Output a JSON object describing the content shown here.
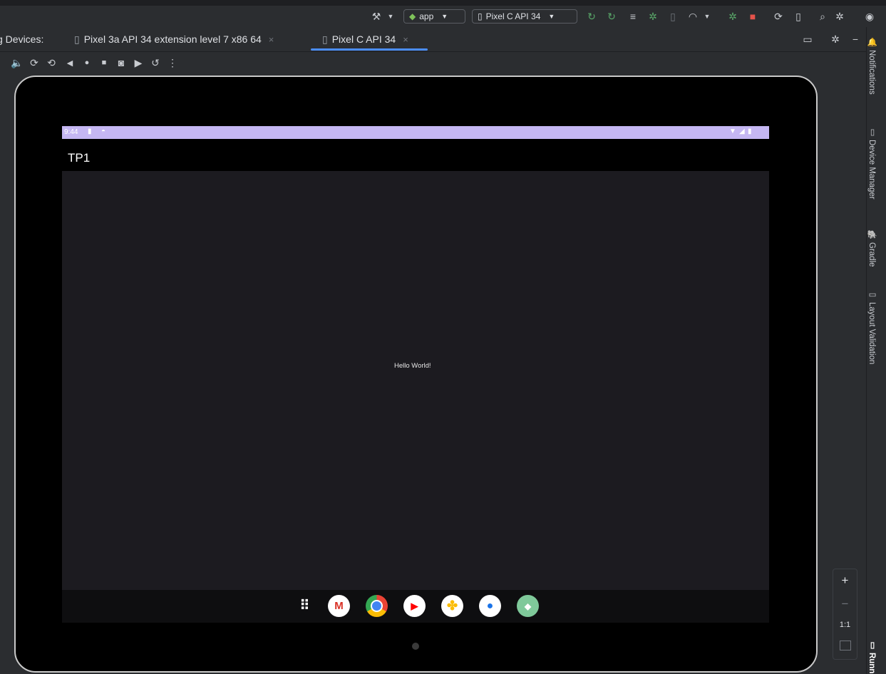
{
  "toolbar": {
    "run_config": "app",
    "device_selector": "Pixel C API 34"
  },
  "tabs": {
    "prefix": "g Devices:",
    "items": [
      {
        "label": "Pixel 3a API 34 extension level 7 x86 64",
        "active": false
      },
      {
        "label": "Pixel C API 34",
        "active": true
      }
    ]
  },
  "right_panel": {
    "notifications": "Notifications",
    "device_manager": "Device Manager",
    "gradle": "Gradle",
    "layout_validation": "Layout Validation",
    "running": "Runn"
  },
  "emulator": {
    "status_time": "9:44",
    "app_title": "TP1",
    "hello_text": "Hello World!"
  },
  "zoom": {
    "plus": "+",
    "minus": "−",
    "one_to_one": "1:1"
  },
  "colors": {
    "status_bar": "#c5b7f3",
    "accent_tab": "#4b8df8",
    "screen_bg": "#1c1b20"
  },
  "icons": {
    "dock": [
      "apps-grid-icon",
      "gmail-icon",
      "chrome-icon",
      "youtube-icon",
      "photos-icon",
      "messages-icon",
      "android-icon"
    ]
  }
}
